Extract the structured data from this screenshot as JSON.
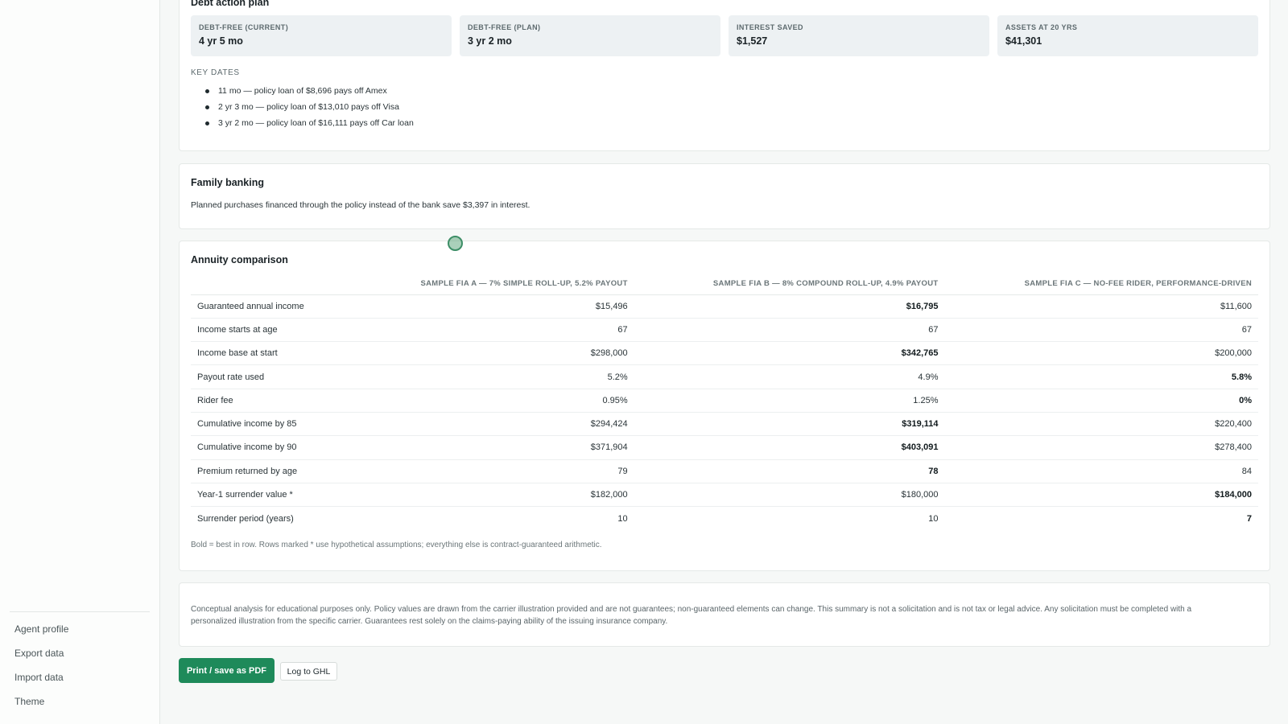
{
  "sidebar": {
    "items": [
      {
        "label": "Agent profile"
      },
      {
        "label": "Export data"
      },
      {
        "label": "Import data"
      },
      {
        "label": "Theme"
      }
    ]
  },
  "debt": {
    "title": "Debt action plan",
    "kpis": [
      {
        "label": "DEBT-FREE (CURRENT)",
        "value": "4 yr 5 mo"
      },
      {
        "label": "DEBT-FREE (PLAN)",
        "value": "3 yr 2 mo"
      },
      {
        "label": "INTEREST SAVED",
        "value": "$1,527"
      },
      {
        "label": "ASSETS AT 20 YRS",
        "value": "$41,301"
      }
    ],
    "key_dates_label": "KEY DATES",
    "key_dates": [
      "11 mo — policy loan of $8,696 pays off Amex",
      "2 yr 3 mo — policy loan of $13,010 pays off Visa",
      "3 yr 2 mo — policy loan of $16,111 pays off Car loan"
    ]
  },
  "family": {
    "title": "Family banking",
    "text": "Planned purchases financed through the policy instead of the bank save $3,397 in interest."
  },
  "annuity": {
    "title": "Annuity comparison",
    "columns": [
      "SAMPLE FIA A — 7% SIMPLE ROLL-UP, 5.2% PAYOUT",
      "SAMPLE FIA B — 8% COMPOUND ROLL-UP, 4.9% PAYOUT",
      "SAMPLE FIA C — NO-FEE RIDER, PERFORMANCE-DRIVEN"
    ],
    "rows": [
      {
        "label": "Guaranteed annual income",
        "values": [
          "$15,496",
          "$16,795",
          "$11,600"
        ],
        "best": 1
      },
      {
        "label": "Income starts at age",
        "values": [
          "67",
          "67",
          "67"
        ],
        "best": -1
      },
      {
        "label": "Income base at start",
        "values": [
          "$298,000",
          "$342,765",
          "$200,000"
        ],
        "best": 1
      },
      {
        "label": "Payout rate used",
        "values": [
          "5.2%",
          "4.9%",
          "5.8%"
        ],
        "best": 2
      },
      {
        "label": "Rider fee",
        "values": [
          "0.95%",
          "1.25%",
          "0%"
        ],
        "best": 2
      },
      {
        "label": "Cumulative income by 85",
        "values": [
          "$294,424",
          "$319,114",
          "$220,400"
        ],
        "best": 1
      },
      {
        "label": "Cumulative income by 90",
        "values": [
          "$371,904",
          "$403,091",
          "$278,400"
        ],
        "best": 1
      },
      {
        "label": "Premium returned by age",
        "values": [
          "79",
          "78",
          "84"
        ],
        "best": 1
      },
      {
        "label": "Year-1 surrender value *",
        "values": [
          "$182,000",
          "$180,000",
          "$184,000"
        ],
        "best": 2
      },
      {
        "label": "Surrender period (years)",
        "values": [
          "10",
          "10",
          "7"
        ],
        "best": 2
      }
    ],
    "note": "Bold = best in row. Rows marked * use hypothetical assumptions; everything else is contract-guaranteed arithmetic."
  },
  "disclaimer": "Conceptual analysis for educational purposes only. Policy values are drawn from the carrier illustration provided and are not guarantees; non-guaranteed elements can change. This summary is not a solicitation and is not tax or legal advice. Any solicitation must be completed with a personalized illustration from the specific carrier. Guarantees rest solely on the claims-paying ability of the issuing insurance company.",
  "actions": {
    "print_label": "Print / save as PDF",
    "log_label": "Log to GHL"
  },
  "colors": {
    "accent": "#1e8a5a",
    "kpi_bg": "#edf1f3"
  }
}
